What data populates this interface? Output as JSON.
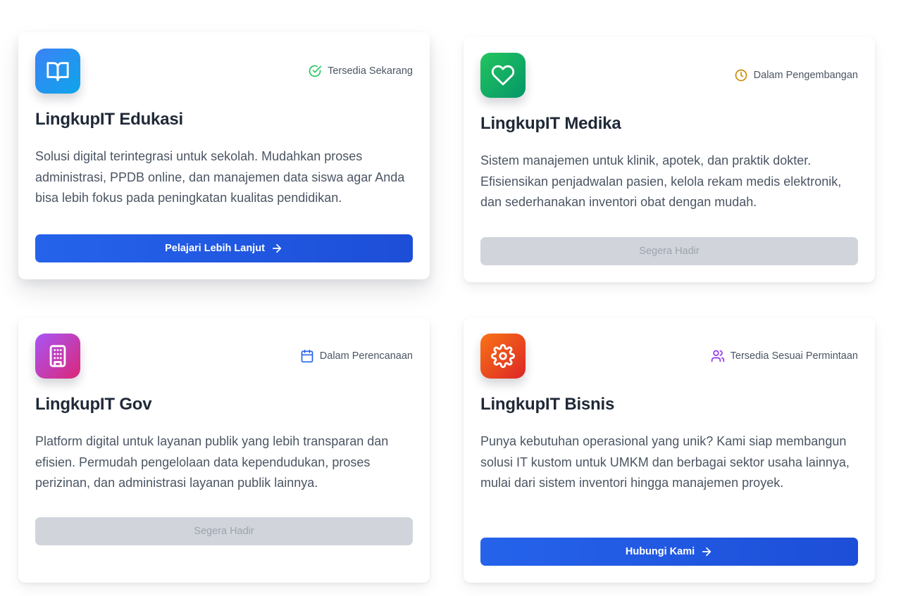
{
  "colors": {
    "primary_button": "#2563eb",
    "disabled_button": "#d1d5db",
    "status_green": "#22c55e",
    "status_amber": "#ca8a04",
    "status_blue": "#2563eb",
    "status_purple": "#9333ea"
  },
  "cards": [
    {
      "title": "LingkupIT Edukasi",
      "icon": "book-open-icon",
      "status": {
        "label": "Tersedia Sekarang",
        "icon": "check-circle-icon"
      },
      "description": "Solusi digital terintegrasi untuk sekolah. Mudahkan proses administrasi, PPDB online, dan manajemen data siswa agar Anda bisa lebih fokus pada peningkatan kualitas pendidikan.",
      "button": {
        "label": "Pelajari Lebih Lanjut",
        "icon": "arrow-right-icon",
        "enabled": true
      }
    },
    {
      "title": "LingkupIT Medika",
      "icon": "heart-icon",
      "status": {
        "label": "Dalam Pengembangan",
        "icon": "clock-icon"
      },
      "description": "Sistem manajemen untuk klinik, apotek, dan praktik dokter. Efisiensikan penjadwalan pasien, kelola rekam medis elektronik, dan sederhanakan inventori obat dengan mudah.",
      "button": {
        "label": "Segera Hadir",
        "enabled": false
      }
    },
    {
      "title": "LingkupIT Gov",
      "icon": "building-icon",
      "status": {
        "label": "Dalam Perencanaan",
        "icon": "calendar-icon"
      },
      "description": "Platform digital untuk layanan publik yang lebih transparan dan efisien. Permudah pengelolaan data kependudukan, proses perizinan, dan administrasi layanan publik lainnya.",
      "button": {
        "label": "Segera Hadir",
        "enabled": false
      }
    },
    {
      "title": "LingkupIT Bisnis",
      "icon": "gear-icon",
      "status": {
        "label": "Tersedia Sesuai Permintaan",
        "icon": "users-icon"
      },
      "description": "Punya kebutuhan operasional yang unik? Kami siap membangun solusi IT kustom untuk UMKM dan berbagai sektor usaha lainnya, mulai dari sistem inventori hingga manajemen proyek.",
      "button": {
        "label": "Hubungi Kami",
        "icon": "arrow-right-icon",
        "enabled": true
      }
    }
  ]
}
